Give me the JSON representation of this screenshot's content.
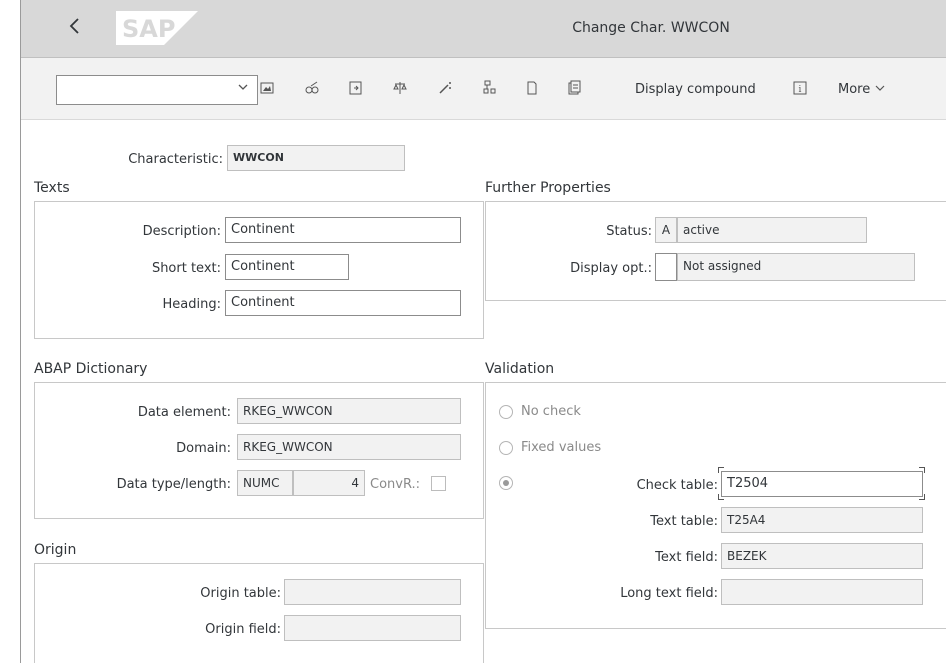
{
  "shell": {
    "title": "Change Char. WWCON",
    "logo": "SAP",
    "back_icon": "chevron-left-icon"
  },
  "toolbar": {
    "select_value": "",
    "icons": [
      "image-icon",
      "glasses-icon",
      "export-icon",
      "balance-icon",
      "magic-wand-icon",
      "hierarchy-icon",
      "document-icon",
      "copy-document-icon",
      "info-icon"
    ],
    "display_compound": "Display compound",
    "more": "More"
  },
  "characteristic": {
    "label": "Characteristic:",
    "value": "WWCON"
  },
  "texts": {
    "title": "Texts",
    "description_label": "Description:",
    "description": "Continent",
    "short_text_label": "Short text:",
    "short_text": "Continent",
    "heading_label": "Heading:",
    "heading": "Continent"
  },
  "further": {
    "title": "Further Properties",
    "status_label": "Status:",
    "status_code": "A",
    "status_text": "active",
    "display_opt_label": "Display opt.:",
    "display_opt_code": "",
    "display_opt_text": "Not assigned"
  },
  "abap": {
    "title": "ABAP Dictionary",
    "data_element_label": "Data element:",
    "data_element": "RKEG_WWCON",
    "domain_label": "Domain:",
    "domain": "RKEG_WWCON",
    "data_type_label": "Data type/length:",
    "data_type": "NUMC",
    "length": "4",
    "convr_label": "ConvR.:"
  },
  "validation": {
    "title": "Validation",
    "no_check": "No check",
    "fixed_values": "Fixed values",
    "check_table_label": "Check table:",
    "check_table": "T2504",
    "text_table_label": "Text table:",
    "text_table": "T25A4",
    "text_field_label": "Text field:",
    "text_field": "BEZEK",
    "long_text_field_label": "Long text field:",
    "long_text_field": ""
  },
  "origin": {
    "title": "Origin",
    "origin_table_label": "Origin table:",
    "origin_table": "",
    "origin_field_label": "Origin field:",
    "origin_field": ""
  }
}
